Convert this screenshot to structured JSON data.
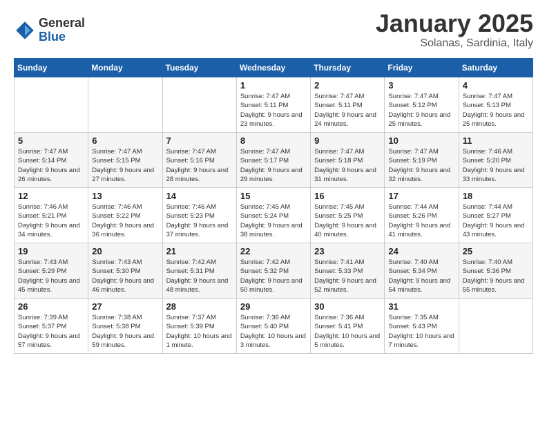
{
  "logo": {
    "general": "General",
    "blue": "Blue"
  },
  "title": {
    "month_year": "January 2025",
    "location": "Solanas, Sardinia, Italy"
  },
  "days_header": [
    "Sunday",
    "Monday",
    "Tuesday",
    "Wednesday",
    "Thursday",
    "Friday",
    "Saturday"
  ],
  "weeks": [
    [
      {
        "day": "",
        "info": ""
      },
      {
        "day": "",
        "info": ""
      },
      {
        "day": "",
        "info": ""
      },
      {
        "day": "1",
        "info": "Sunrise: 7:47 AM\nSunset: 5:11 PM\nDaylight: 9 hours and 23 minutes."
      },
      {
        "day": "2",
        "info": "Sunrise: 7:47 AM\nSunset: 5:11 PM\nDaylight: 9 hours and 24 minutes."
      },
      {
        "day": "3",
        "info": "Sunrise: 7:47 AM\nSunset: 5:12 PM\nDaylight: 9 hours and 25 minutes."
      },
      {
        "day": "4",
        "info": "Sunrise: 7:47 AM\nSunset: 5:13 PM\nDaylight: 9 hours and 25 minutes."
      }
    ],
    [
      {
        "day": "5",
        "info": "Sunrise: 7:47 AM\nSunset: 5:14 PM\nDaylight: 9 hours and 26 minutes."
      },
      {
        "day": "6",
        "info": "Sunrise: 7:47 AM\nSunset: 5:15 PM\nDaylight: 9 hours and 27 minutes."
      },
      {
        "day": "7",
        "info": "Sunrise: 7:47 AM\nSunset: 5:16 PM\nDaylight: 9 hours and 28 minutes."
      },
      {
        "day": "8",
        "info": "Sunrise: 7:47 AM\nSunset: 5:17 PM\nDaylight: 9 hours and 29 minutes."
      },
      {
        "day": "9",
        "info": "Sunrise: 7:47 AM\nSunset: 5:18 PM\nDaylight: 9 hours and 31 minutes."
      },
      {
        "day": "10",
        "info": "Sunrise: 7:47 AM\nSunset: 5:19 PM\nDaylight: 9 hours and 32 minutes."
      },
      {
        "day": "11",
        "info": "Sunrise: 7:46 AM\nSunset: 5:20 PM\nDaylight: 9 hours and 33 minutes."
      }
    ],
    [
      {
        "day": "12",
        "info": "Sunrise: 7:46 AM\nSunset: 5:21 PM\nDaylight: 9 hours and 34 minutes."
      },
      {
        "day": "13",
        "info": "Sunrise: 7:46 AM\nSunset: 5:22 PM\nDaylight: 9 hours and 36 minutes."
      },
      {
        "day": "14",
        "info": "Sunrise: 7:46 AM\nSunset: 5:23 PM\nDaylight: 9 hours and 37 minutes."
      },
      {
        "day": "15",
        "info": "Sunrise: 7:45 AM\nSunset: 5:24 PM\nDaylight: 9 hours and 38 minutes."
      },
      {
        "day": "16",
        "info": "Sunrise: 7:45 AM\nSunset: 5:25 PM\nDaylight: 9 hours and 40 minutes."
      },
      {
        "day": "17",
        "info": "Sunrise: 7:44 AM\nSunset: 5:26 PM\nDaylight: 9 hours and 41 minutes."
      },
      {
        "day": "18",
        "info": "Sunrise: 7:44 AM\nSunset: 5:27 PM\nDaylight: 9 hours and 43 minutes."
      }
    ],
    [
      {
        "day": "19",
        "info": "Sunrise: 7:43 AM\nSunset: 5:29 PM\nDaylight: 9 hours and 45 minutes."
      },
      {
        "day": "20",
        "info": "Sunrise: 7:43 AM\nSunset: 5:30 PM\nDaylight: 9 hours and 46 minutes."
      },
      {
        "day": "21",
        "info": "Sunrise: 7:42 AM\nSunset: 5:31 PM\nDaylight: 9 hours and 48 minutes."
      },
      {
        "day": "22",
        "info": "Sunrise: 7:42 AM\nSunset: 5:32 PM\nDaylight: 9 hours and 50 minutes."
      },
      {
        "day": "23",
        "info": "Sunrise: 7:41 AM\nSunset: 5:33 PM\nDaylight: 9 hours and 52 minutes."
      },
      {
        "day": "24",
        "info": "Sunrise: 7:40 AM\nSunset: 5:34 PM\nDaylight: 9 hours and 54 minutes."
      },
      {
        "day": "25",
        "info": "Sunrise: 7:40 AM\nSunset: 5:36 PM\nDaylight: 9 hours and 55 minutes."
      }
    ],
    [
      {
        "day": "26",
        "info": "Sunrise: 7:39 AM\nSunset: 5:37 PM\nDaylight: 9 hours and 57 minutes."
      },
      {
        "day": "27",
        "info": "Sunrise: 7:38 AM\nSunset: 5:38 PM\nDaylight: 9 hours and 59 minutes."
      },
      {
        "day": "28",
        "info": "Sunrise: 7:37 AM\nSunset: 5:39 PM\nDaylight: 10 hours and 1 minute."
      },
      {
        "day": "29",
        "info": "Sunrise: 7:36 AM\nSunset: 5:40 PM\nDaylight: 10 hours and 3 minutes."
      },
      {
        "day": "30",
        "info": "Sunrise: 7:36 AM\nSunset: 5:41 PM\nDaylight: 10 hours and 5 minutes."
      },
      {
        "day": "31",
        "info": "Sunrise: 7:35 AM\nSunset: 5:43 PM\nDaylight: 10 hours and 7 minutes."
      },
      {
        "day": "",
        "info": ""
      }
    ]
  ]
}
